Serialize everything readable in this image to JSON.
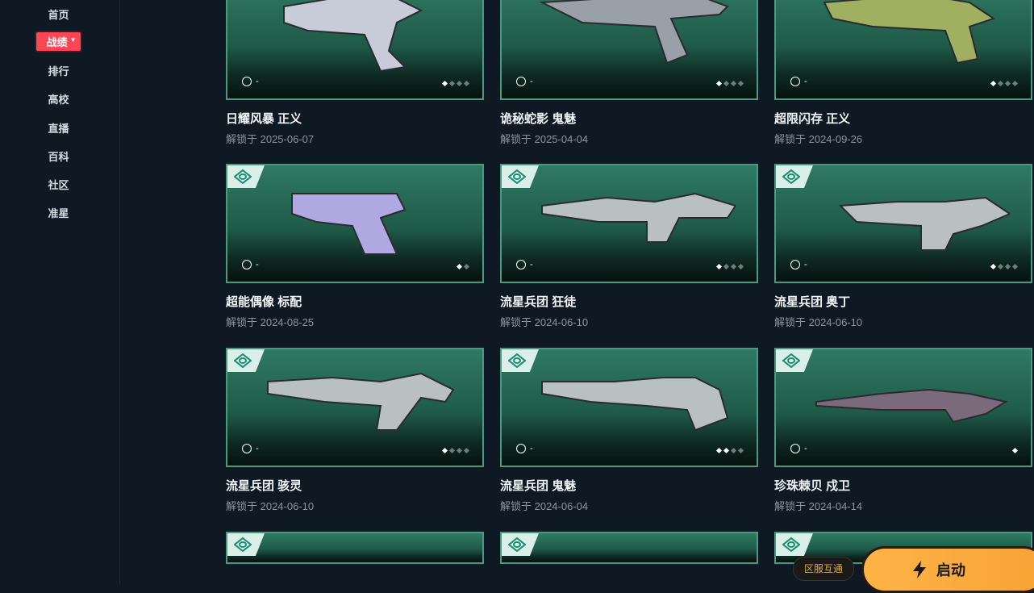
{
  "sidebar": {
    "items": [
      {
        "label": "首页",
        "active": false
      },
      {
        "label": "战绩",
        "active": true
      },
      {
        "label": "排行",
        "active": false
      },
      {
        "label": "高校",
        "active": false
      },
      {
        "label": "直播",
        "active": false
      },
      {
        "label": "百科",
        "active": false
      },
      {
        "label": "社区",
        "active": false
      },
      {
        "label": "准星",
        "active": false
      }
    ]
  },
  "skins": [
    {
      "name": "日耀风暴 正义",
      "date": "解锁于 2025-06-07",
      "buddy": "-",
      "levels_total": 4,
      "levels_on": 1
    },
    {
      "name": "诡秘蛇影 鬼魅",
      "date": "解锁于 2025-04-04",
      "buddy": "-",
      "levels_total": 4,
      "levels_on": 1
    },
    {
      "name": "超限闪存 正义",
      "date": "解锁于 2024-09-26",
      "buddy": "-",
      "levels_total": 4,
      "levels_on": 1
    },
    {
      "name": "超能偶像 标配",
      "date": "解锁于 2024-08-25",
      "buddy": "-",
      "levels_total": 2,
      "levels_on": 1
    },
    {
      "name": "流星兵团 狂徒",
      "date": "解锁于 2024-06-10",
      "buddy": "-",
      "levels_total": 4,
      "levels_on": 1
    },
    {
      "name": "流星兵团 奥丁",
      "date": "解锁于 2024-06-10",
      "buddy": "-",
      "levels_total": 4,
      "levels_on": 1
    },
    {
      "name": "流星兵团 骇灵",
      "date": "解锁于 2024-06-10",
      "buddy": "-",
      "levels_total": 4,
      "levels_on": 1
    },
    {
      "name": "流星兵团 鬼魅",
      "date": "解锁于 2024-06-04",
      "buddy": "-",
      "levels_total": 4,
      "levels_on": 2
    },
    {
      "name": "珍珠棘贝 戍卫",
      "date": "解锁于 2024-04-14",
      "buddy": "-",
      "levels_total": 1,
      "levels_on": 1
    }
  ],
  "footer": {
    "region_label": "区服互通",
    "launch_label": "启动"
  },
  "colors": {
    "accent": "#ff4655",
    "card_border": "#4a9a82",
    "launch": "#f7a336"
  },
  "icons": {
    "tier": "tier-diamond-icon",
    "buddy": "buddy-icon",
    "launch": "lightning-icon",
    "dropdown": "caret-down-icon"
  }
}
